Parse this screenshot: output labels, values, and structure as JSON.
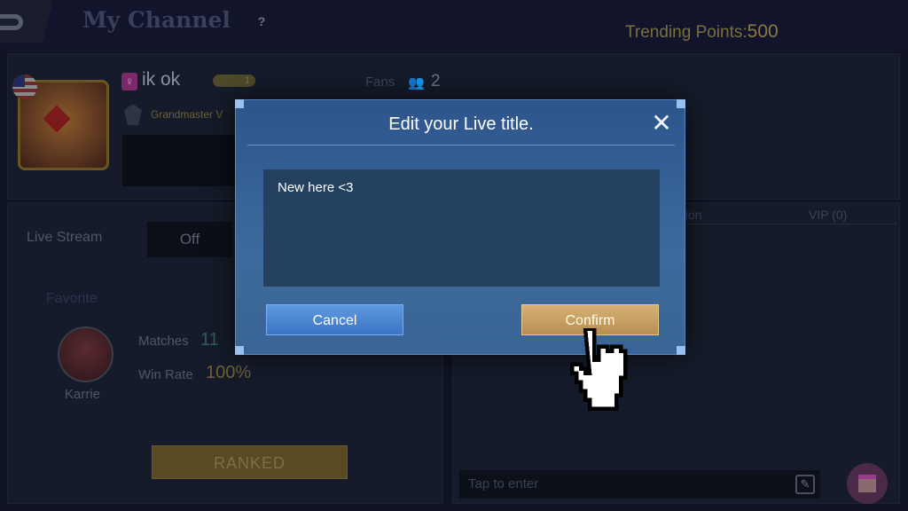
{
  "header": {
    "title": "My Channel",
    "help_icon": "?",
    "trending_label": "Trending Points:",
    "trending_value": "500"
  },
  "profile": {
    "name": "ik ok",
    "level_badge": "1",
    "rank": "Grandmaster V",
    "fans_label": "Fans",
    "fans_count": "2"
  },
  "left": {
    "live_stream_label": "Live Stream",
    "live_stream_value": "Off",
    "favorite_label": "Favorite",
    "hero_name": "Karrie",
    "matches_label": "Matches",
    "matches_value": "11",
    "win_rate_label": "Win Rate",
    "win_rate_value": "100%",
    "mode_button": "RANKED"
  },
  "right": {
    "tabs": [
      {
        "label": "Contribution"
      },
      {
        "label": "VIP (0)"
      }
    ],
    "chat_placeholder": "Tap to enter"
  },
  "dialog": {
    "title": "Edit your Live title.",
    "text_value": "New here <3",
    "cancel_label": "Cancel",
    "confirm_label": "Confirm"
  },
  "colors": {
    "accent_gold": "#c9a464",
    "dialog_blue": "#35609a",
    "cancel_blue": "#4a86d4",
    "teal_value": "#3c8a86"
  }
}
